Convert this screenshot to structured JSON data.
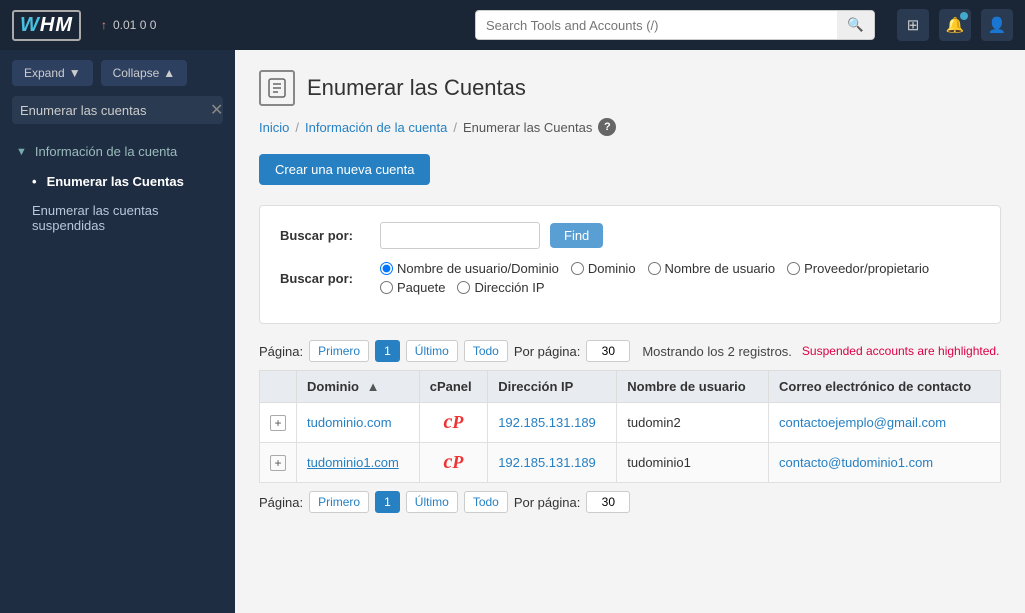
{
  "topbar": {
    "logo_text": "WHM",
    "server_stats": "0.01  0  0",
    "search_placeholder": "Search Tools and Accounts (/)",
    "arrow_symbol": "↑"
  },
  "sidebar": {
    "expand_label": "Expand",
    "collapse_label": "Collapse",
    "search_value": "Enumerar las cuentas",
    "section": {
      "label": "Información de la cuenta",
      "items": [
        {
          "label": "Enumerar las Cuentas",
          "active": true
        },
        {
          "label": "Enumerar las cuentas suspendidas",
          "active": false
        }
      ]
    }
  },
  "page": {
    "title": "Enumerar las Cuentas",
    "breadcrumbs": [
      {
        "label": "Inicio",
        "link": true
      },
      {
        "label": "Información de la cuenta",
        "link": true
      },
      {
        "label": "Enumerar las Cuentas",
        "link": false
      }
    ],
    "create_button": "Crear una nueva cuenta"
  },
  "search_panel": {
    "buscar_por_label": "Buscar por:",
    "find_button": "Find",
    "radio_options": [
      "Nombre de usuario/Dominio",
      "Dominio",
      "Nombre de usuario",
      "Proveedor/propietario",
      "Paquete",
      "Dirección IP"
    ],
    "default_radio": "Nombre de usuario/Dominio"
  },
  "table_controls": {
    "page_label": "Página:",
    "first_btn": "Primero",
    "page_num": "1",
    "last_btn": "Último",
    "all_btn": "Todo",
    "per_page_label": "Por página:",
    "per_page_value": "30",
    "records_text": "Mostrando los 2 registros.",
    "suspended_text": "Suspended accounts are highlighted."
  },
  "table": {
    "columns": [
      "",
      "Dominio",
      "cPanel",
      "Dirección IP",
      "Nombre de usuario",
      "Correo electrónico de contacto"
    ],
    "rows": [
      {
        "domain": "tudominio.com",
        "cpanel": "cP",
        "ip": "192.185.131.189",
        "username": "tudomin2",
        "email": "contactoejemplo@gmail.com"
      },
      {
        "domain": "tudominio1.com",
        "cpanel": "cP",
        "ip": "192.185.131.189",
        "username": "tudominio1",
        "email": "contacto@tudominio1.com"
      }
    ]
  },
  "bottom_controls": {
    "page_label": "Página:",
    "first_btn": "Primero",
    "page_num": "1",
    "last_btn": "Último",
    "all_btn": "Todo",
    "per_page_label": "Por página:",
    "per_page_value": "30"
  }
}
